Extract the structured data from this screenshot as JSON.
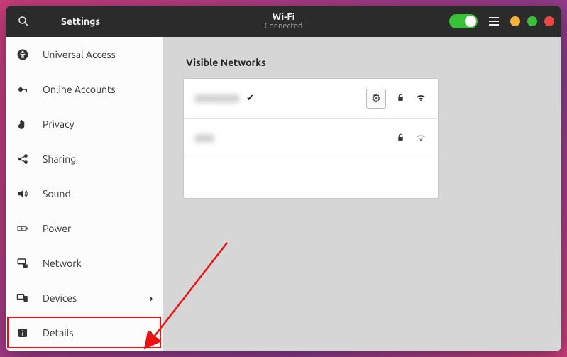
{
  "titlebar": {
    "app_title": "Settings",
    "center_main": "Wi-Fi",
    "center_sub": "Connected"
  },
  "sidebar": {
    "items": [
      {
        "label": "Universal Access",
        "icon": "accessibility-icon",
        "has_chevron": false
      },
      {
        "label": "Online Accounts",
        "icon": "cloud-key-icon",
        "has_chevron": false
      },
      {
        "label": "Privacy",
        "icon": "hand-icon",
        "has_chevron": false
      },
      {
        "label": "Sharing",
        "icon": "share-icon",
        "has_chevron": false
      },
      {
        "label": "Sound",
        "icon": "speaker-icon",
        "has_chevron": false
      },
      {
        "label": "Power",
        "icon": "battery-icon",
        "has_chevron": false
      },
      {
        "label": "Network",
        "icon": "network-icon",
        "has_chevron": false
      },
      {
        "label": "Devices",
        "icon": "devices-icon",
        "has_chevron": true
      },
      {
        "label": "Details",
        "icon": "info-icon",
        "has_chevron": true
      }
    ]
  },
  "content": {
    "section_title": "Visible Networks",
    "networks": [
      {
        "ssid": "XXXXXXX",
        "connected": true,
        "secure": true,
        "signal": "strong"
      },
      {
        "ssid": "XXX",
        "connected": false,
        "secure": true,
        "signal": "weak"
      }
    ]
  },
  "glyphs": {
    "chevron": "›",
    "check": "✔",
    "lock": "🔒",
    "wifi_strong": "▲",
    "wifi_weak": "△",
    "gear": "⚙"
  }
}
